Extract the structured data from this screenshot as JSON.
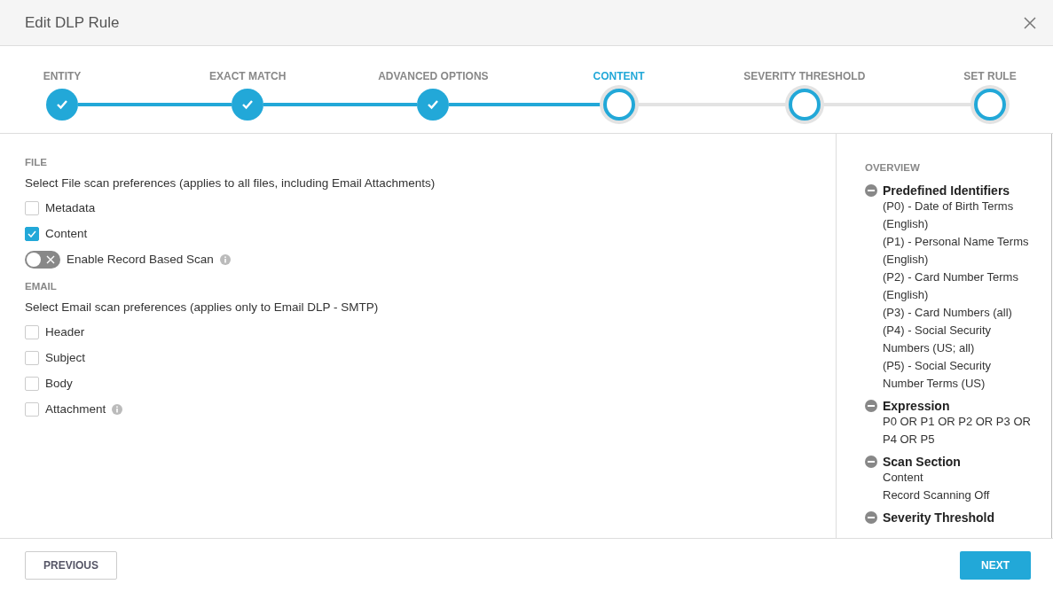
{
  "dialog": {
    "title": "Edit DLP Rule"
  },
  "steps": [
    {
      "label": "ENTITY",
      "completed": true,
      "selected": false
    },
    {
      "label": "EXACT MATCH",
      "completed": true,
      "selected": false
    },
    {
      "label": "ADVANCED OPTIONS",
      "completed": true,
      "selected": false
    },
    {
      "label": "CONTENT",
      "completed": false,
      "selected": true
    },
    {
      "label": "SEVERITY THRESHOLD",
      "completed": false,
      "selected": false
    },
    {
      "label": "SET RULE",
      "completed": false,
      "selected": false
    }
  ],
  "sections": [
    {
      "heading": "FILE",
      "description": "Select File scan preferences (applies to all files, including Email Attachments)",
      "options": [
        {
          "kind": "checkbox",
          "label": "Metadata",
          "checked": false,
          "info": false
        },
        {
          "kind": "checkbox",
          "label": "Content",
          "checked": true,
          "info": false
        },
        {
          "kind": "toggle",
          "label": "Enable Record Based Scan",
          "on": false,
          "info": true
        }
      ]
    },
    {
      "heading": "EMAIL",
      "description": "Select Email scan preferences (applies only to Email DLP - SMTP)",
      "options": [
        {
          "kind": "checkbox",
          "label": "Header",
          "checked": false,
          "info": false
        },
        {
          "kind": "checkbox",
          "label": "Subject",
          "checked": false,
          "info": false
        },
        {
          "kind": "checkbox",
          "label": "Body",
          "checked": false,
          "info": false
        },
        {
          "kind": "checkbox",
          "label": "Attachment",
          "checked": false,
          "info": true
        }
      ]
    }
  ],
  "overview": {
    "heading": "OVERVIEW",
    "groups": [
      {
        "title": "Predefined Identifiers",
        "lines": [
          "(P0) - Date of Birth Terms (English)",
          "(P1) - Personal Name Terms (English)",
          "(P2) - Card Number Terms (English)",
          "(P3) - Card Numbers (all)",
          "(P4) - Social Security Numbers (US; all)",
          "(P5) - Social Security Number Terms (US)"
        ]
      },
      {
        "title": "Expression",
        "lines": [
          "P0 OR P1 OR P2 OR P3 OR P4 OR P5"
        ]
      },
      {
        "title": "Scan Section",
        "lines": [
          "Content",
          "Record Scanning Off"
        ]
      },
      {
        "title": "Severity Threshold"
      }
    ]
  },
  "footer": {
    "previous": "PREVIOUS",
    "next": "NEXT"
  }
}
